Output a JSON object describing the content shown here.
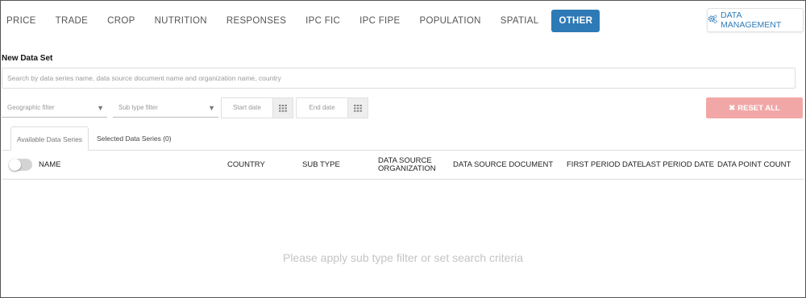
{
  "nav": {
    "items": [
      {
        "label": "PRICE"
      },
      {
        "label": "TRADE"
      },
      {
        "label": "CROP"
      },
      {
        "label": "NUTRITION"
      },
      {
        "label": "RESPONSES"
      },
      {
        "label": "IPC FIC"
      },
      {
        "label": "IPC FIPE"
      },
      {
        "label": "POPULATION"
      },
      {
        "label": "SPATIAL"
      },
      {
        "label": "OTHER",
        "active": true
      }
    ],
    "data_management_label": "DATA MANAGEMENT",
    "data_management_icon": "gears-icon",
    "accent_color": "#2e7ab6"
  },
  "section_title": "New Data Set",
  "search": {
    "value": "",
    "placeholder": "Search by data series name, data source document name and organization name, country"
  },
  "filters": {
    "geographic_placeholder": "Geographic filter",
    "subtype_placeholder": "Sub type filter",
    "start_date_placeholder": "Start date",
    "end_date_placeholder": "End date",
    "calendar_icon": "calendar-grid-icon",
    "dropdown_icon": "caret-down-icon"
  },
  "reset": {
    "label": "RESET ALL",
    "icon": "times-icon",
    "color": "#f2a7a7"
  },
  "tabs": {
    "available": "Available Data Series",
    "selected": "Selected Data Series (0)"
  },
  "table": {
    "columns": [
      "NAME",
      "COUNTRY",
      "SUB TYPE",
      "DATA SOURCE ORGANIZATION",
      "DATA SOURCE DOCUMENT",
      "FIRST PERIOD DATE",
      "LAST PERIOD DATE",
      "DATA POINT COUNT"
    ],
    "select_all_toggle": false,
    "rows": []
  },
  "empty_message": "Please apply sub type filter or set search criteria"
}
